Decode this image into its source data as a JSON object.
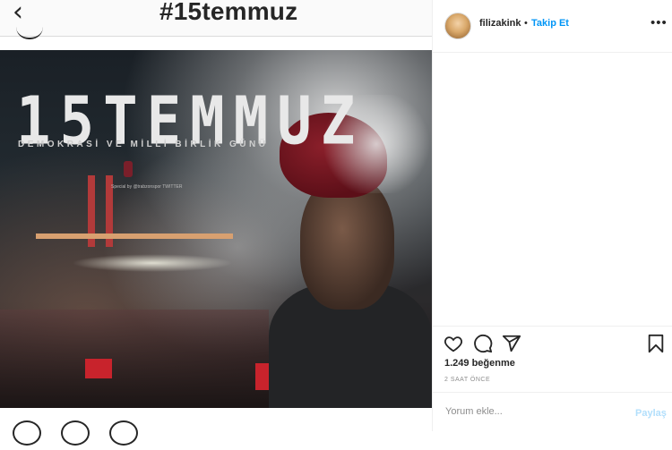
{
  "background_page": {
    "back_glyph": "‹",
    "hashtag": "#15temmuz"
  },
  "post_image": {
    "title": "15TEMMUZ",
    "subtitle": "DEMOKRASİ VE MİLLİ BİRLİK GÜNÜ",
    "credit": "Special by @trabzonspor TWITTER",
    "colors": {
      "beret": "#7a1a24",
      "flag": "#c8232c"
    }
  },
  "panel": {
    "username": "filizakink",
    "dot": "•",
    "follow_label": "Takip Et",
    "more_label": "•••",
    "likes": "1.249 beğenme",
    "time": "2 SAAT ÖNCE",
    "comment_placeholder": "Yorum ekle...",
    "share_label": "Paylaş",
    "icons": [
      "heart-icon",
      "comment-icon",
      "send-icon",
      "bookmark-icon"
    ],
    "colors": {
      "accent": "#0095f6",
      "share_disabled": "#b2dffc"
    }
  }
}
